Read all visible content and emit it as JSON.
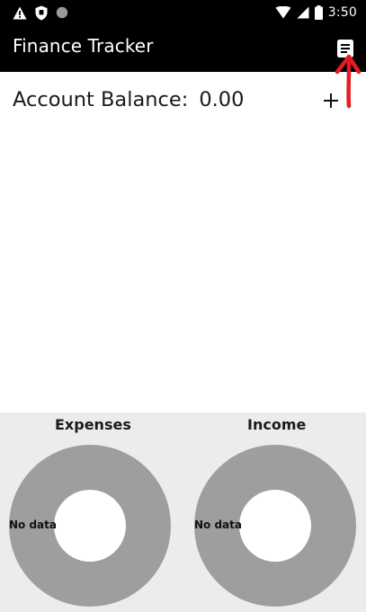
{
  "status_bar": {
    "time": "3:50",
    "left_icons": [
      "warning-icon",
      "shield-icon",
      "record-dot-icon"
    ],
    "right_icons": [
      "wifi-icon",
      "signal-icon",
      "battery-icon"
    ]
  },
  "app_bar": {
    "title": "Finance Tracker",
    "menu_icon": "list-menu-icon"
  },
  "balance": {
    "label": "Account Balance:",
    "value": "0.00",
    "add_label": "+"
  },
  "charts": {
    "expenses": {
      "title": "Expenses",
      "empty_text": "No data"
    },
    "income": {
      "title": "Income",
      "empty_text": "No data"
    }
  },
  "colors": {
    "bar_background": "#000000",
    "panel_background": "#ececec",
    "donut_fill": "#9e9e9e",
    "annotation_arrow": "#e51c23"
  }
}
